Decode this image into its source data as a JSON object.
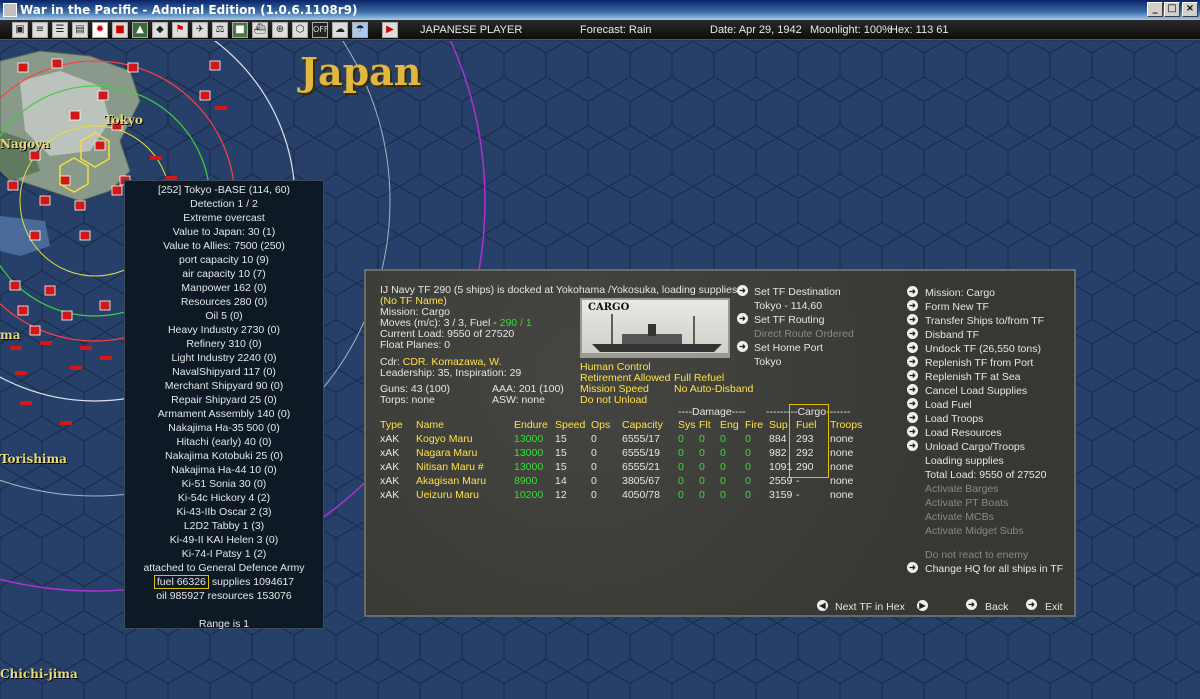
{
  "window": {
    "title": "War in the Pacific - Admiral Edition (1.0.6.1108r9)",
    "buttons": [
      "_",
      "□",
      "×"
    ]
  },
  "toolbar": {
    "player": "JAPANESE PLAYER",
    "forecast": "Forecast: Rain",
    "date": "Date: Apr 29, 1942",
    "moonlight": "Moonlight: 100%",
    "hex": "Hex: 113  61"
  },
  "map": {
    "region_label": "Japan",
    "places": [
      "Tokyo",
      "Nagoya",
      "Torishima",
      "Chichi-jima",
      "ma"
    ]
  },
  "base_popup": {
    "lines": [
      "[252] Tokyo -BASE (114, 60)",
      "Detection 1 / 2",
      "Extreme overcast",
      "Value to Japan: 30 (1)",
      "Value to Allies: 7500 (250)",
      "port capacity 10 (9)",
      "air capacity 10 (7)",
      "Manpower  162 (0)",
      "Resources  280 (0)",
      "Oil  5 (0)",
      "Heavy Industry  2730 (0)",
      "Refinery  310 (0)",
      "Light Industry  2240 (0)",
      "NavalShipyard  117 (0)",
      "Merchant Shipyard  90 (0)",
      "Repair Shipyard  25 (0)",
      "Armament Assembly  140 (0)",
      "Nakajima Ha-35  500 (0)",
      "Hitachi (early)  40 (0)",
      "Nakajima Kotobuki  25 (0)",
      "Nakajima Ha-44  10 (0)",
      "Ki-51 Sonia  30 (0)",
      "Ki-54c Hickory  4 (2)",
      "Ki-43-IIb Oscar  2 (3)",
      "L2D2 Tabby  1 (3)",
      "Ki-49-II KAI Helen  3 (0)",
      "Ki-74-I Patsy  1 (2)",
      "attached to General Defence Army"
    ],
    "fuel": "fuel 66326",
    "supplies": "supplies 1094617",
    "oil_resources": "oil 985927  resources 153076",
    "range": "Range is 1"
  },
  "tf": {
    "header": "IJ Navy TF 290 (5 ships) is docked at Yokohama /Yokosuka, loading supplies",
    "no_tf_name": "(No TF Name)",
    "mission": "Mission: Cargo",
    "moves_prefix": "Moves (m/c): 3 / 3, Fuel - ",
    "moves_fuel": "290 / 1",
    "current_load": "Current Load: 9550 of 27520",
    "float_planes": "Float Planes: 0",
    "cdr_label": "Cdr:",
    "cdr_name": "CDR. Komazawa, W.",
    "leadership": "Leadership: 35, Inspiration: 29",
    "guns": "Guns: 43 (100)",
    "aaa": "AAA: 201 (100)",
    "torps": "Torps: none",
    "asw": "ASW: none",
    "cargo_image_label": "CARGO",
    "options_left": [
      "Human Control",
      "Retirement Allowed",
      "Mission Speed",
      "Do not Unload"
    ],
    "options_right": [
      "Full Refuel",
      "No Auto-Disband"
    ],
    "destination": {
      "set_dest": "Set TF Destination",
      "dest_value": "Tokyo - 114,60",
      "set_routing": "Set TF Routing",
      "routing_value": "Direct Route Ordered",
      "set_home": "Set Home Port",
      "home_value": "Tokyo"
    },
    "damage_header": "----Damage----",
    "cargo_header": "---------Cargo-------",
    "columns": [
      "Type",
      "Name",
      "Endure",
      "Speed",
      "Ops",
      "Capacity",
      "Sys",
      "Flt",
      "Eng",
      "Fire",
      "Sup",
      "Fuel",
      "Troops"
    ],
    "ships": [
      {
        "type": "xAK",
        "name": "Kogyo Maru",
        "endure": "13000",
        "speed": "15",
        "ops": "0",
        "capacity": "6555/17",
        "sys": "0",
        "flt": "0",
        "eng": "0",
        "fire": "0",
        "sup": "884",
        "fuel": "293",
        "troops": "none"
      },
      {
        "type": "xAK",
        "name": "Nagara Maru",
        "endure": "13000",
        "speed": "15",
        "ops": "0",
        "capacity": "6555/19",
        "sys": "0",
        "flt": "0",
        "eng": "0",
        "fire": "0",
        "sup": "982",
        "fuel": "292",
        "troops": "none"
      },
      {
        "type": "xAK",
        "name": "Nitisan Maru #",
        "endure": "13000",
        "speed": "15",
        "ops": "0",
        "capacity": "6555/21",
        "sys": "0",
        "flt": "0",
        "eng": "0",
        "fire": "0",
        "sup": "1091",
        "fuel": "290",
        "troops": "none"
      },
      {
        "type": "xAK",
        "name": "Akagisan Maru",
        "endure": "8900",
        "speed": "14",
        "ops": "0",
        "capacity": "3805/67",
        "sys": "0",
        "flt": "0",
        "eng": "0",
        "fire": "0",
        "sup": "2559",
        "fuel": "-",
        "troops": "none"
      },
      {
        "type": "xAK",
        "name": "Ueizuru Maru",
        "endure": "10200",
        "speed": "12",
        "ops": "0",
        "capacity": "4050/78",
        "sys": "0",
        "flt": "0",
        "eng": "0",
        "fire": "0",
        "sup": "3159",
        "fuel": "-",
        "troops": "none"
      }
    ],
    "commands": {
      "active": [
        "Mission: Cargo",
        "Form New TF",
        "Transfer Ships to/from TF",
        "Disband TF",
        "Undock TF (26,550 tons)",
        "Replenish TF from Port",
        "Replenish TF at Sea",
        "Cancel Load Supplies",
        "Load Fuel",
        "Load Troops",
        "Load Resources",
        "Unload Cargo/Troops"
      ],
      "status": [
        "Loading supplies",
        "Total Load: 9550 of 27520"
      ],
      "inactive": [
        "Activate Barges",
        "Activate PT Boats",
        "Activate MCBs",
        "Activate Midget Subs"
      ],
      "no_react": "Do not react to enemy",
      "change_hq": "Change HQ for all ships in TF"
    },
    "nav": {
      "next_tf": "Next TF in Hex",
      "back": "Back",
      "exit": "Exit"
    }
  }
}
